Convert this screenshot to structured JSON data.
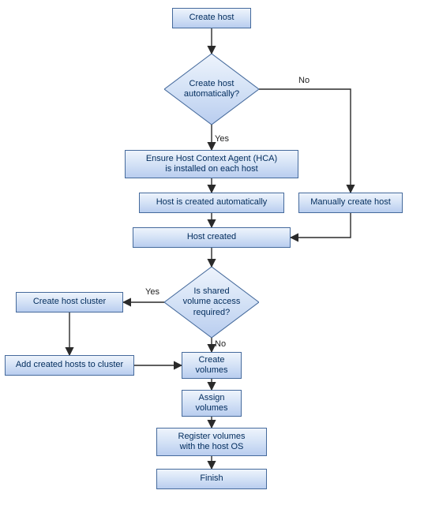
{
  "nodes": {
    "start": "Create host",
    "d1": "Create host\nautomatically?",
    "hca": "Ensure Host Context Agent (HCA)\nis installed on each host",
    "autocreate": "Host is created automatically",
    "manual": "Manually create host",
    "hostcreated": "Host created",
    "d2": "Is shared\nvolume access\nrequired?",
    "createcluster": "Create host cluster",
    "addhosts": "Add created hosts to cluster",
    "createvolumes": "Create\nvolumes",
    "assignvolumes": "Assign\nvolumes",
    "register": "Register volumes\nwith the host OS",
    "finish": "Finish"
  },
  "labels": {
    "d1_yes": "Yes",
    "d1_no": "No",
    "d2_yes": "Yes",
    "d2_no": "No"
  }
}
